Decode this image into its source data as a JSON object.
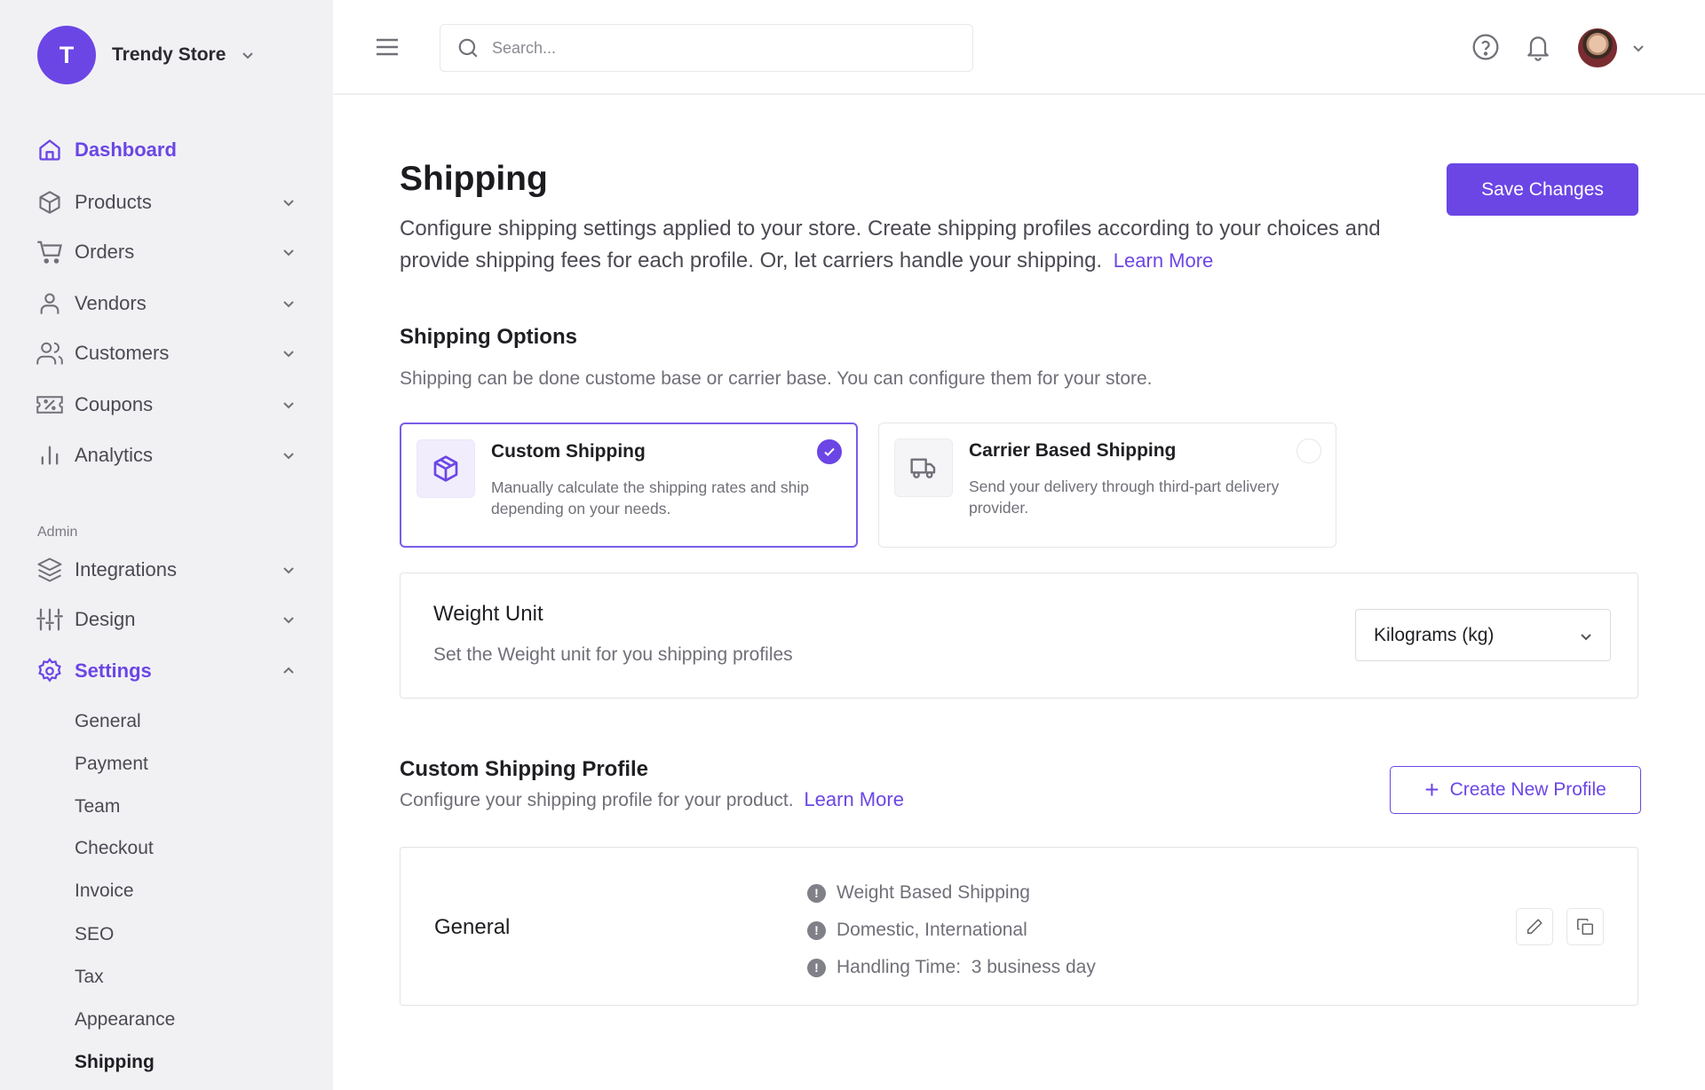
{
  "store": {
    "initial": "T",
    "name": "Trendy Store",
    "accent": "#6b46e5"
  },
  "sidebar": {
    "items": [
      {
        "label": "Dashboard",
        "icon": "home-icon"
      },
      {
        "label": "Products",
        "icon": "box-icon"
      },
      {
        "label": "Orders",
        "icon": "cart-icon"
      },
      {
        "label": "Vendors",
        "icon": "user-icon"
      },
      {
        "label": "Customers",
        "icon": "users-icon"
      },
      {
        "label": "Coupons",
        "icon": "coupon-icon"
      },
      {
        "label": "Analytics",
        "icon": "bar-chart-icon"
      }
    ],
    "admin_label": "Admin",
    "admin_items": [
      {
        "label": "Integrations",
        "icon": "layers-icon"
      },
      {
        "label": "Design",
        "icon": "sliders-icon"
      },
      {
        "label": "Settings",
        "icon": "gear-icon"
      }
    ],
    "settings_sub": [
      "General",
      "Payment",
      "Team",
      "Checkout",
      "Invoice",
      "SEO",
      "Tax",
      "Appearance",
      "Shipping"
    ]
  },
  "topbar": {
    "search_placeholder": "Search..."
  },
  "page": {
    "title": "Shipping",
    "description": "Configure shipping settings applied to your store. Create shipping profiles according to your choices and provide shipping fees for each profile. Or, let carriers handle your shipping.",
    "learn_more": "Learn More",
    "save_label": "Save Changes"
  },
  "shipping_options": {
    "title": "Shipping Options",
    "description": "Shipping can be done custome base or carrier base. You can configure them for your store.",
    "options": [
      {
        "title": "Custom Shipping",
        "description": "Manually calculate the shipping rates and ship depending on your needs.",
        "selected": true
      },
      {
        "title": "Carrier Based Shipping",
        "description": "Send your delivery through third-part delivery provider.",
        "selected": false
      }
    ]
  },
  "weight_unit": {
    "title": "Weight Unit",
    "description": "Set the Weight unit for you shipping profiles",
    "selected": "Kilograms (kg)"
  },
  "profiles": {
    "title": "Custom Shipping Profile",
    "description": "Configure your shipping profile for your product.",
    "learn_more": "Learn More",
    "create_label": "Create New Profile",
    "items": [
      {
        "name": "General",
        "features": [
          "Weight Based Shipping",
          "Domestic, International",
          "Handling Time:  3 business day"
        ]
      }
    ]
  }
}
